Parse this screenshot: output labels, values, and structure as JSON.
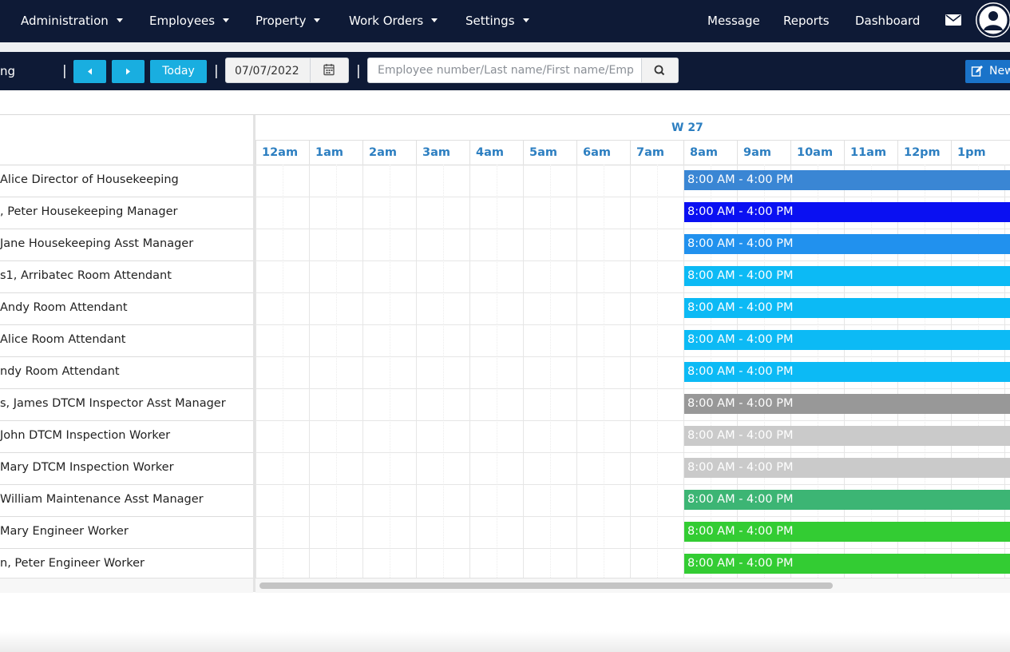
{
  "nav": {
    "menus": [
      "Administration",
      "Employees",
      "Property",
      "Work Orders",
      "Settings"
    ],
    "links": [
      "Message",
      "Reports",
      "Dashboard"
    ],
    "mail_icon": "envelope-icon",
    "avatar_icon": "user-circle-icon"
  },
  "toolbar": {
    "title": "ng",
    "prev_icon": "caret-left-icon",
    "next_icon": "caret-right-icon",
    "today_label": "Today",
    "date_value": "07/07/2022",
    "calendar_icon": "calendar-icon",
    "search_placeholder": "Employee number/Last name/First name/Employee",
    "search_icon": "magnifier-icon",
    "new_label": "New",
    "new_icon": "edit-icon"
  },
  "schedule": {
    "week_label": "W 27",
    "hours": [
      "12am",
      "1am",
      "2am",
      "3am",
      "4am",
      "5am",
      "6am",
      "7am",
      "8am",
      "9am",
      "10am",
      "11am",
      "12pm",
      "1pm"
    ],
    "rows": [
      {
        "name": "Alice Director of Housekeeping",
        "shift": "8:00 AM - 4:00 PM",
        "color": "#3a86d4"
      },
      {
        "name": ", Peter Housekeeping Manager",
        "shift": "8:00 AM - 4:00 PM",
        "color": "#0a10f2"
      },
      {
        "name": "Jane Housekeeping Asst Manager",
        "shift": "8:00 AM - 4:00 PM",
        "color": "#2191ee"
      },
      {
        "name": "s1, Arribatec Room Attendant",
        "shift": "8:00 AM - 4:00 PM",
        "color": "#0cbaf5"
      },
      {
        "name": " Andy Room Attendant",
        "shift": "8:00 AM - 4:00 PM",
        "color": "#0cbaf5"
      },
      {
        "name": " Alice Room Attendant",
        "shift": "8:00 AM - 4:00 PM",
        "color": "#0cbaf5"
      },
      {
        "name": "ndy Room Attendant",
        "shift": "8:00 AM - 4:00 PM",
        "color": "#0cbaf5"
      },
      {
        "name": "s, James DTCM Inspector Asst Manager",
        "shift": "8:00 AM - 4:00 PM",
        "color": "#989898"
      },
      {
        "name": " John DTCM Inspection Worker",
        "shift": "8:00 AM - 4:00 PM",
        "color": "#cacaca"
      },
      {
        "name": "Mary DTCM Inspection Worker",
        "shift": "8:00 AM - 4:00 PM",
        "color": "#cacaca"
      },
      {
        "name": " William Maintenance Asst Manager",
        "shift": "8:00 AM - 4:00 PM",
        "color": "#3cb574"
      },
      {
        "name": " Mary Engineer Worker",
        "shift": "8:00 AM - 4:00 PM",
        "color": "#33cc33"
      },
      {
        "name": "n, Peter Engineer Worker",
        "shift": "8:00 AM - 4:00 PM",
        "color": "#33cc33"
      }
    ]
  }
}
